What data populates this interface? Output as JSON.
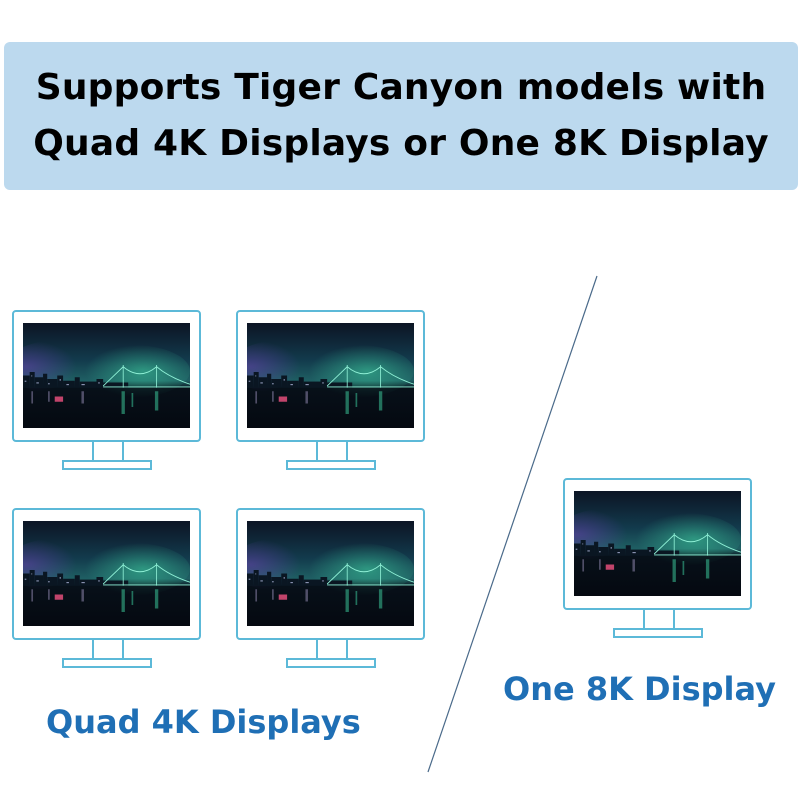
{
  "banner": {
    "line1": "Supports Tiger Canyon models with",
    "line2": "Quad 4K Displays or One 8K Display"
  },
  "captions": {
    "quad": "Quad 4K Displays",
    "one": "One 8K Display"
  },
  "colors": {
    "banner_bg": "#bcd9ee",
    "monitor_outline": "#5cb9d8",
    "caption_text": "#1f6fb5"
  },
  "icons": {
    "monitor": "monitor-icon",
    "screen_image": "night-city-bridge-image"
  }
}
